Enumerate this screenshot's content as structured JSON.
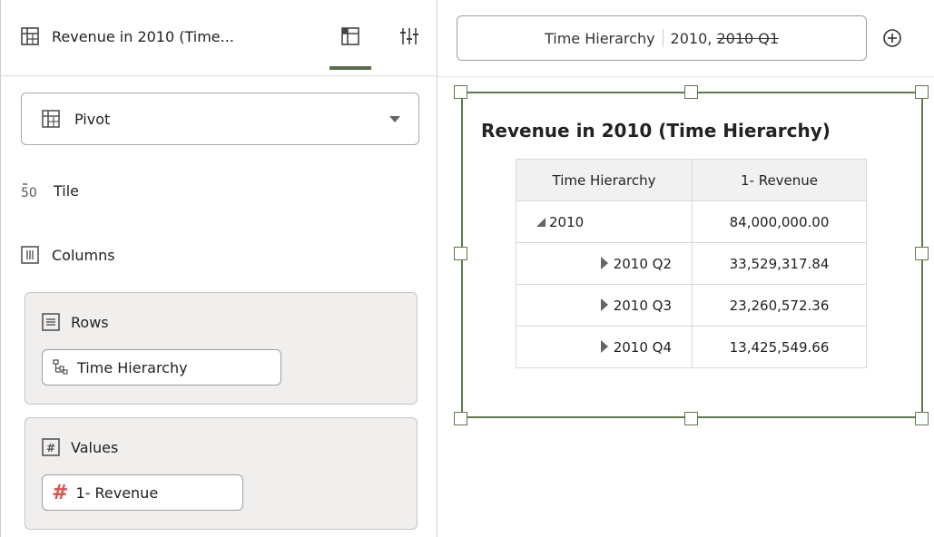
{
  "header": {
    "viz_title": "Revenue in 2010 (Time...",
    "tabs": [
      {
        "name": "grammar-tab-icon",
        "active": true
      },
      {
        "name": "properties-tab-icon",
        "active": false
      }
    ]
  },
  "viz_type": {
    "label": "Pivot"
  },
  "grammar": {
    "tile_label": "Tile",
    "columns_label": "Columns",
    "rows": {
      "label": "Rows",
      "pill": "Time Hierarchy"
    },
    "values": {
      "label": "Values",
      "pill": "1- Revenue"
    }
  },
  "filter": {
    "name": "Time Hierarchy",
    "value_kept": "2010,",
    "value_excluded": "2010 Q1"
  },
  "canvas": {
    "title": "Revenue in 2010 (Time Hierarchy)",
    "table": {
      "headers": [
        "Time Hierarchy",
        "1- Revenue"
      ],
      "rows": [
        {
          "label": "2010",
          "value": "84,000,000.00",
          "expanded": true
        },
        {
          "label": "2010 Q2",
          "value": "33,529,317.84",
          "expanded": false
        },
        {
          "label": "2010 Q3",
          "value": "23,260,572.36",
          "expanded": false
        },
        {
          "label": "2010 Q4",
          "value": "13,425,549.66",
          "expanded": false
        }
      ]
    }
  },
  "colors": {
    "accent": "#5f7a4c",
    "measure": "#d9534f"
  }
}
